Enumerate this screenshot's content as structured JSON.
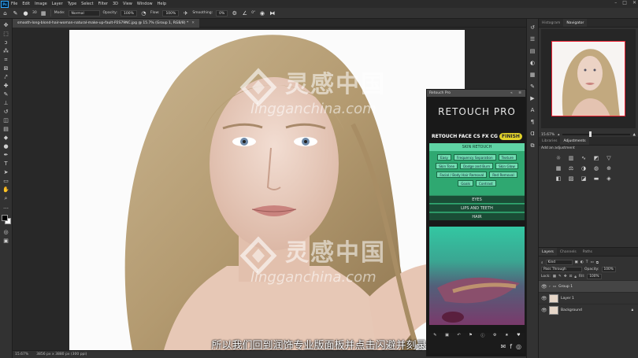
{
  "menubar": {
    "items": [
      "File",
      "Edit",
      "Image",
      "Layer",
      "Type",
      "Select",
      "Filter",
      "3D",
      "View",
      "Window",
      "Help"
    ],
    "app_badge": "Ps",
    "window_controls": [
      "–",
      "□",
      "✕"
    ]
  },
  "options": {
    "mode_label": "Mode:",
    "mode_value": "Normal",
    "opacity_label": "Opacity:",
    "opacity_value": "100%",
    "flow_label": "Flow:",
    "flow_value": "100%",
    "smoothing_label": "Smoothing:",
    "smoothing_value": "0%",
    "brush_size": "30",
    "angle_value": "0°"
  },
  "document": {
    "tab_title": "smooth-long-blond-hair-woman-natural-make-up-fault-P2S79NC.jpg @ 15.7% (Group 1, RGB/8) *",
    "zoom": "15.67%",
    "dimensions": "3856 px x 3880 px (300 ppi)"
  },
  "panels": {
    "navigator_tabs": [
      "Histogram",
      "Navigator"
    ],
    "navigator_active": "Navigator",
    "navigator_zoom": "15.67%",
    "adjust_tabs": [
      "Libraries",
      "Adjustments"
    ],
    "adjust_active": "Adjustments",
    "add_adjustment": "Add an adjustment",
    "layers_tabs": [
      "Layers",
      "Channels",
      "Paths"
    ],
    "layers_active": "Layers",
    "kind_label": "Kind",
    "blend_mode": "Pass Through",
    "opacity_label": "Opacity:",
    "opacity_value": "100%",
    "lock_label": "Lock:",
    "fill_label": "Fill:",
    "fill_value": "100%",
    "layers": [
      {
        "name": "Group 1",
        "selected": true,
        "type": "group"
      },
      {
        "name": "Layer 1",
        "selected": false,
        "type": "pixel"
      },
      {
        "name": "Background",
        "selected": false,
        "type": "pixel"
      }
    ]
  },
  "retouch": {
    "window_title": "Retouch Pro",
    "logo": "RETOUCH PRO",
    "nav": [
      "RETOUCH",
      "FACE",
      "CS",
      "FX",
      "CG",
      "FINISH"
    ],
    "skin_header": "SKIN RETOUCH",
    "skin_buttons": [
      "Easy",
      "Frequency Separation",
      "Texture",
      "Skin Tone",
      "Dodge and Burn",
      "Skin Glow",
      "Facial / Body Hair Removal",
      "Red Removal",
      "Goals",
      "Contrast"
    ],
    "sections": [
      "EYES",
      "LIPS AND TEETH",
      "HAIR"
    ]
  },
  "watermark": {
    "cn": "灵感中国",
    "url": "lingganchina.com"
  },
  "subtitle": "所以我们回到润饰专业版面板并点击闪避并刻录"
}
